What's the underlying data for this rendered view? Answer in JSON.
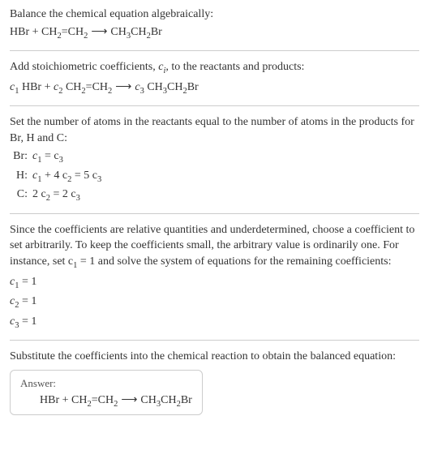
{
  "section1": {
    "line1": "Balance the chemical equation algebraically:",
    "eq_r1": "HBr",
    "eq_plus": " + ",
    "eq_r2a": "CH",
    "eq_r2b": "=CH",
    "eq_arrow": "⟶",
    "eq_p1a": "CH",
    "eq_p1b": "CH",
    "eq_p1c": "Br"
  },
  "section2": {
    "line1a": "Add stoichiometric coefficients, ",
    "line1b": ", to the reactants and products:",
    "ci": "c",
    "ci_sub": "i",
    "c1": "c",
    "c2": "c",
    "c3": "c"
  },
  "section3": {
    "line1": "Set the number of atoms in the reactants equal to the number of atoms in the products for Br, H and C:",
    "labels": [
      "Br:",
      "H:",
      "C:"
    ],
    "eq1a": "c",
    "eq1b": " = c",
    "eq2a": "c",
    "eq2b": " + 4 c",
    "eq2c": " = 5 c",
    "eq3a": "2 c",
    "eq3b": " = 2 c"
  },
  "section4": {
    "line1": "Since the coefficients are relative quantities and underdetermined, choose a coefficient to set arbitrarily. To keep the coefficients small, the arbitrary value is ordinarily one. For instance, set c",
    "line1b": " = 1 and solve the system of equations for the remaining coefficients:",
    "r1a": "c",
    "r1b": " = 1",
    "r2a": "c",
    "r2b": " = 1",
    "r3a": "c",
    "r3b": " = 1"
  },
  "section5": {
    "line1": "Substitute the coefficients into the chemical reaction to obtain the balanced equation:",
    "answer_label": "Answer:"
  },
  "subs": {
    "s1": "1",
    "s2": "2",
    "s3": "3"
  }
}
